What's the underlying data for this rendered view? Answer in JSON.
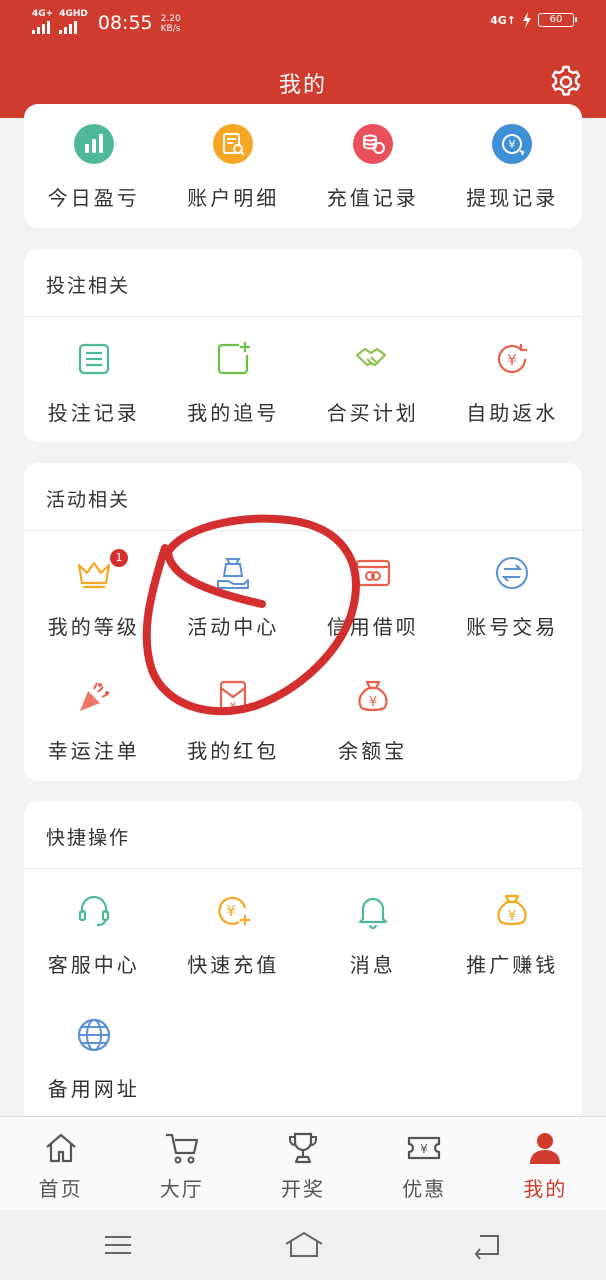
{
  "status_bar": {
    "signal1": "4G+",
    "signal2": "4GHD",
    "time": "08:55",
    "speed_value": "2.20",
    "speed_unit": "KB/s",
    "network": "4G↑",
    "battery": "60"
  },
  "header": {
    "title": "我的",
    "settings_icon": "gear-icon"
  },
  "finance": {
    "items": [
      {
        "label": "今日盈亏",
        "icon": "bar-chart-icon",
        "color": "#4db89a"
      },
      {
        "label": "账户明细",
        "icon": "document-search-icon",
        "color": "#f5a623"
      },
      {
        "label": "充值记录",
        "icon": "coin-stack-icon",
        "color": "#e8505b"
      },
      {
        "label": "提现记录",
        "icon": "yen-transfer-icon",
        "color": "#3d8fd6"
      }
    ]
  },
  "betting": {
    "title": "投注相关",
    "items": [
      {
        "label": "投注记录",
        "icon": "list-icon",
        "color": "#4db89a"
      },
      {
        "label": "我的追号",
        "icon": "add-square-icon",
        "color": "#6cc04a"
      },
      {
        "label": "合买计划",
        "icon": "handshake-icon",
        "color": "#8bc34a"
      },
      {
        "label": "自助返水",
        "icon": "yen-refresh-icon",
        "color": "#e8604c"
      }
    ]
  },
  "activity": {
    "title": "活动相关",
    "badge": "1",
    "items": [
      {
        "label": "我的等级",
        "icon": "crown-icon",
        "color": "#f5a623"
      },
      {
        "label": "活动中心",
        "icon": "gift-hand-icon",
        "color": "#5b8fd6"
      },
      {
        "label": "信用借呗",
        "icon": "credit-card-icon",
        "color": "#e8604c"
      },
      {
        "label": "账号交易",
        "icon": "exchange-icon",
        "color": "#5b8fd6"
      },
      {
        "label": "幸运注单",
        "icon": "party-popper-icon",
        "color": "#e8604c"
      },
      {
        "label": "我的红包",
        "icon": "red-envelope-icon",
        "color": "#e8604c"
      },
      {
        "label": "余额宝",
        "icon": "money-bag-icon",
        "color": "#e8604c"
      }
    ]
  },
  "quick": {
    "title": "快捷操作",
    "items": [
      {
        "label": "客服中心",
        "icon": "headset-icon",
        "color": "#4db89a"
      },
      {
        "label": "快速充值",
        "icon": "yen-add-icon",
        "color": "#f5a623"
      },
      {
        "label": "消息",
        "icon": "bell-icon",
        "color": "#4db89a"
      },
      {
        "label": "推广赚钱",
        "icon": "money-bag-icon",
        "color": "#f5a623"
      },
      {
        "label": "备用网址",
        "icon": "globe-icon",
        "color": "#5b8fd6"
      }
    ]
  },
  "tabbar": {
    "items": [
      {
        "label": "首页",
        "icon": "home-icon"
      },
      {
        "label": "大厅",
        "icon": "cart-icon"
      },
      {
        "label": "开奖",
        "icon": "trophy-icon"
      },
      {
        "label": "优惠",
        "icon": "ticket-icon"
      },
      {
        "label": "我的",
        "icon": "user-icon",
        "active": true
      }
    ],
    "active_color": "#cf3c2e"
  },
  "annotation": {
    "color": "#d32f2f",
    "highlights": "活动中心"
  }
}
